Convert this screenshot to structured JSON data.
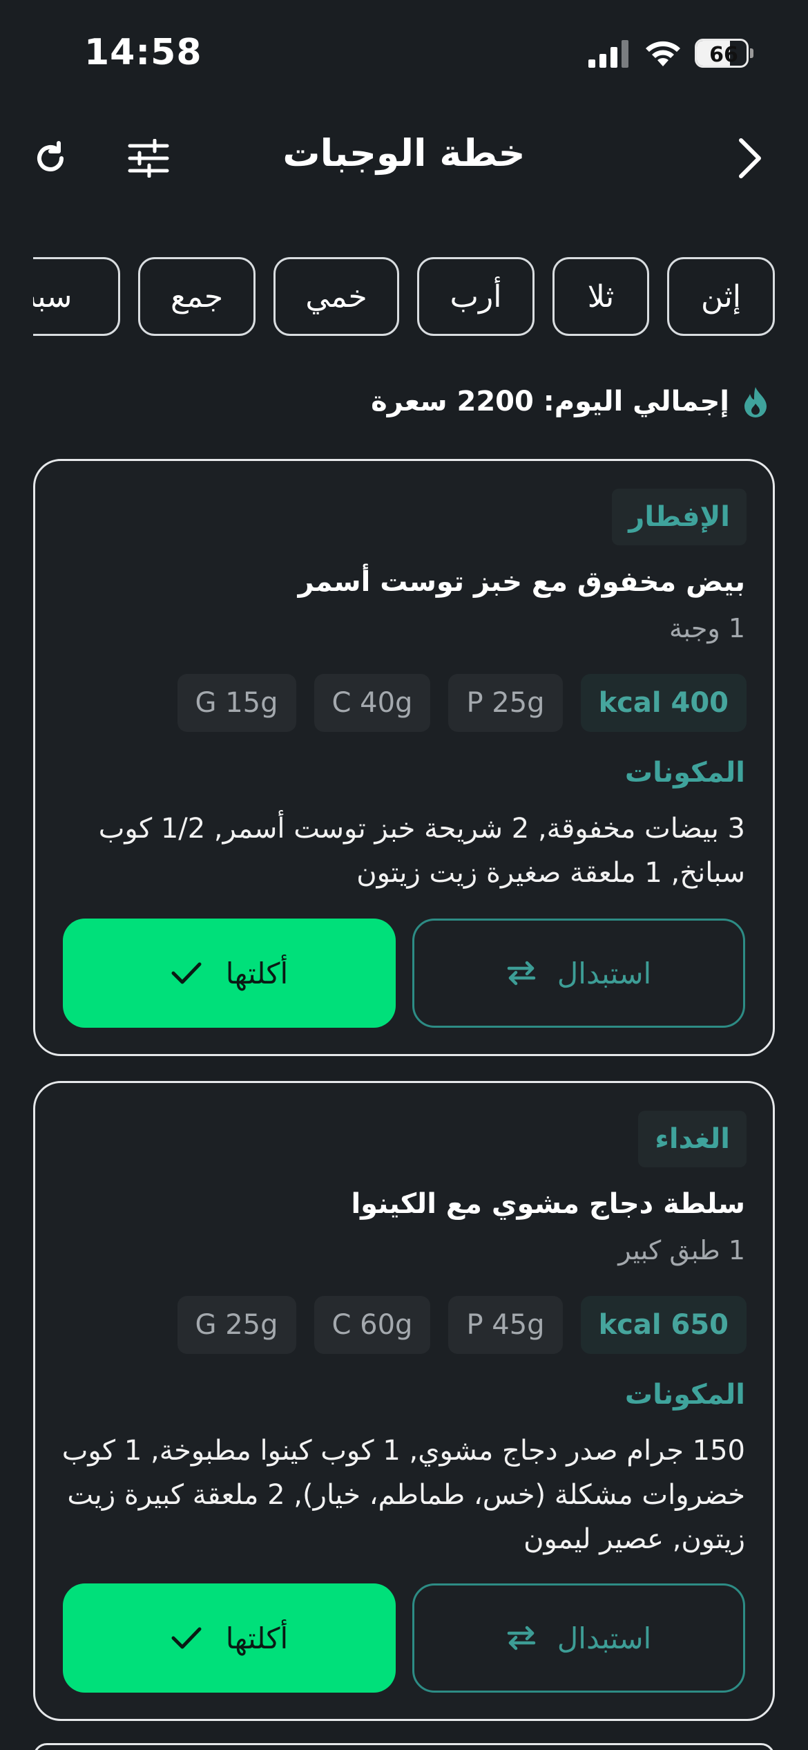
{
  "status_bar": {
    "time": "14:58",
    "battery": "66",
    "battery_level_percent": 66
  },
  "header": {
    "title": "خطة الوجبات"
  },
  "icons": {
    "refresh": "refresh-icon",
    "filters": "sliders-icon",
    "next": "chevron-right-icon",
    "total": "flame-icon",
    "swap": "swap-arrows-icon",
    "ate": "checkmark-icon"
  },
  "days": [
    "إثن",
    "ثلا",
    "أرب",
    "خمي",
    "جمع",
    "سبت"
  ],
  "summary": {
    "total_text": "إجمالي اليوم: 2200 سعرة"
  },
  "ingredients_title": "المكونات",
  "buttons": {
    "swap": "استبدال",
    "ate": "أكلتها"
  },
  "meals": [
    {
      "tag": "الإفطار",
      "name": "بيض مخفوق مع خبز توست أسمر",
      "portion": "1 وجبة",
      "macros": {
        "kcal": "kcal 400",
        "protein": "P 25g",
        "carbs": "C 40g",
        "fat": "G 15g"
      },
      "ingredients": "3 بيضات مخفوقة, 2 شريحة خبز توست أسمر, 1/2 كوب سبانخ, 1 ملعقة صغيرة زيت زيتون"
    },
    {
      "tag": "الغداء",
      "name": "سلطة دجاج مشوي مع الكينوا",
      "portion": "1 طبق كبير",
      "macros": {
        "kcal": "kcal 650",
        "protein": "P 45g",
        "carbs": "C 60g",
        "fat": "G 25g"
      },
      "ingredients": "150 جرام صدر دجاج مشوي, 1 كوب كينوا مطبوخة, 1 كوب خضروات مشكلة (خس، طماطم، خيار), 2 ملعقة كبيرة زيت زيتون, عصير ليمون"
    }
  ],
  "colors": {
    "background": "#1a1e22",
    "accent_teal": "#3fa39c",
    "accent_green": "#00e07a",
    "pill": "#262a2e"
  }
}
